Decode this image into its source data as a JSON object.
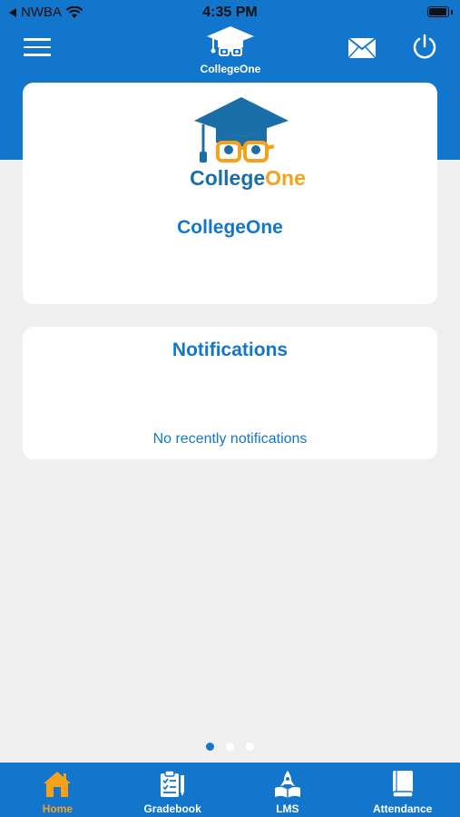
{
  "status_bar": {
    "carrier": "NWBA",
    "time": "4:35 PM",
    "battery_level": 0.95
  },
  "header": {
    "app_name": "CollegeOne",
    "menu_icon": "hamburger-menu-icon",
    "mail_icon": "envelope-icon",
    "power_icon": "power-icon"
  },
  "home_card": {
    "logo_text_college": "College",
    "logo_text_one": "One",
    "title": "CollegeOne"
  },
  "notifications_card": {
    "title": "Notifications",
    "empty_message": "No recently notifications"
  },
  "pager": {
    "count": 3,
    "active_index": 0
  },
  "tabs": [
    {
      "label": "Home",
      "icon": "home-icon",
      "active": true
    },
    {
      "label": "Gradebook",
      "icon": "gradebook-icon",
      "active": false
    },
    {
      "label": "LMS",
      "icon": "lms-rocket-book-icon",
      "active": false
    },
    {
      "label": "Attendance",
      "icon": "attendance-book-icon",
      "active": false
    }
  ],
  "colors": {
    "brand_blue": "#1277cc",
    "logo_orange": "#f7a11a",
    "background": "#efefef",
    "logo_dark_blue": "#1b6fa8"
  }
}
